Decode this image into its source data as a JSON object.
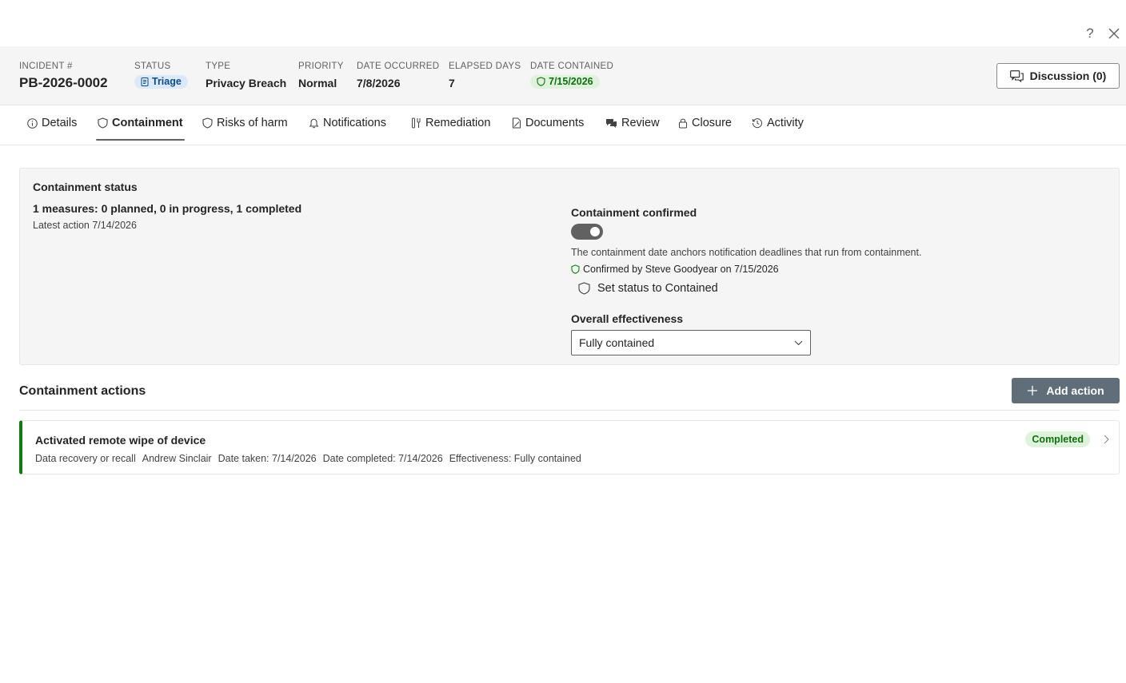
{
  "header": {
    "incident": {
      "label": "Incident #",
      "value": "PB-2026-0002"
    },
    "status": {
      "label": "Status",
      "value": "Triage"
    },
    "type": {
      "label": "Type",
      "value": "Privacy Breach"
    },
    "priority": {
      "label": "Priority",
      "value": "Normal"
    },
    "date_occurred": {
      "label": "Date occurred",
      "value": "7/8/2026"
    },
    "elapsed_days": {
      "label": "Elapsed days",
      "value": "7"
    },
    "date_contained": {
      "label": "Date contained",
      "value": "7/15/2026"
    },
    "discussion_label": "Discussion (0)"
  },
  "tabs": [
    {
      "label": "Details",
      "icon": "info-icon"
    },
    {
      "label": "Containment",
      "icon": "shield-icon",
      "active": true
    },
    {
      "label": "Risks of harm",
      "icon": "shield-icon"
    },
    {
      "label": "Notifications",
      "icon": "bell-icon"
    },
    {
      "label": "Remediation",
      "icon": "tools-icon"
    },
    {
      "label": "Documents",
      "icon": "document-icon"
    },
    {
      "label": "Review",
      "icon": "chat-icon"
    },
    {
      "label": "Closure",
      "icon": "lock-icon"
    },
    {
      "label": "Activity",
      "icon": "history-icon"
    }
  ],
  "containment_status": {
    "title": "Containment status",
    "summary": "1 measures: 0 planned, 0 in progress, 1 completed",
    "latest": "Latest action 7/14/2026",
    "confirmed_label": "Containment confirmed",
    "toggle_on": true,
    "anchor_note": "The containment date anchors notification deadlines that run from containment.",
    "confirmed_by": "Confirmed by Steve Goodyear on 7/15/2026",
    "set_status_label": "Set status to Contained",
    "effectiveness_label": "Overall effectiveness",
    "effectiveness_value": "Fully contained"
  },
  "actions": {
    "title": "Containment actions",
    "add_label": "Add action",
    "items": [
      {
        "title": "Activated remote wipe of device",
        "category": "Data recovery or recall",
        "owner": "Andrew Sinclair",
        "date_taken": "Date taken: 7/14/2026",
        "date_completed": "Date completed: 7/14/2026",
        "effectiveness": "Effectiveness: Fully contained",
        "status": "Completed"
      }
    ]
  },
  "colors": {
    "accent_green": "#107c10",
    "badge_blue_bg": "#dbe9f8",
    "badge_green_bg": "#dff3dc",
    "primary_button": "#5f6e78"
  }
}
